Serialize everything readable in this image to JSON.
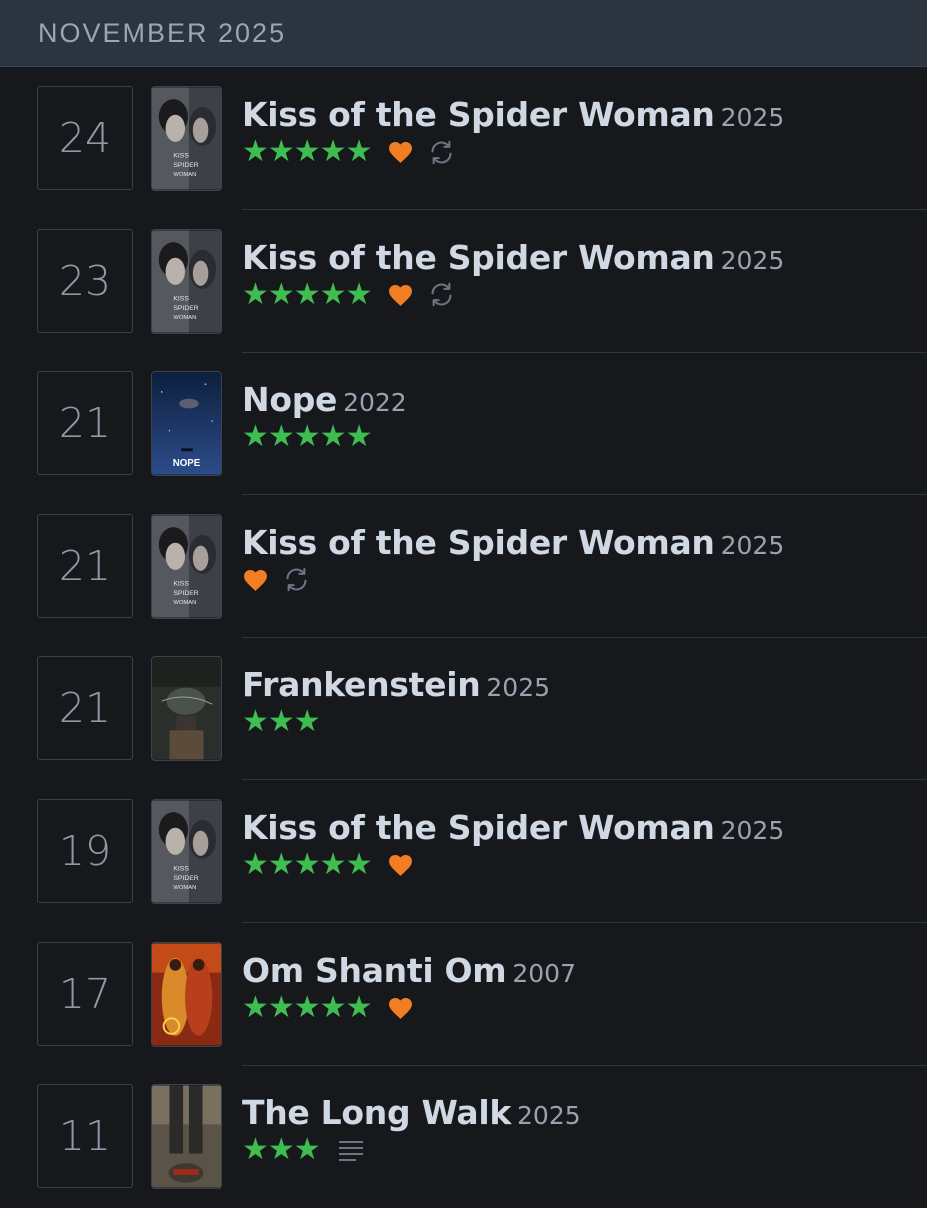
{
  "header": {
    "month": "NOVEMBER 2025"
  },
  "colors": {
    "star": "#40bd50",
    "heart": "#f27d22",
    "icon_muted": "#6b7683"
  },
  "entries": [
    {
      "day": "24",
      "title": "Kiss of the Spider Woman",
      "year": "2025",
      "stars": "★★★★★",
      "liked": true,
      "rewatch": true,
      "review": false,
      "poster": "spider-woman-poster"
    },
    {
      "day": "23",
      "title": "Kiss of the Spider Woman",
      "year": "2025",
      "stars": "★★★★★",
      "liked": true,
      "rewatch": true,
      "review": false,
      "poster": "spider-woman-poster"
    },
    {
      "day": "21",
      "title": "Nope",
      "year": "2022",
      "stars": "★★★★★",
      "liked": false,
      "rewatch": false,
      "review": false,
      "poster": "nope-poster"
    },
    {
      "day": "21",
      "title": "Kiss of the Spider Woman",
      "year": "2025",
      "stars": "",
      "liked": true,
      "rewatch": true,
      "review": false,
      "poster": "spider-woman-poster"
    },
    {
      "day": "21",
      "title": "Frankenstein",
      "year": "2025",
      "stars": "★★★",
      "liked": false,
      "rewatch": false,
      "review": false,
      "poster": "frankenstein-poster"
    },
    {
      "day": "19",
      "title": "Kiss of the Spider Woman",
      "year": "2025",
      "stars": "★★★★★",
      "liked": true,
      "rewatch": false,
      "review": false,
      "poster": "spider-woman-poster"
    },
    {
      "day": "17",
      "title": "Om Shanti Om",
      "year": "2007",
      "stars": "★★★★★",
      "liked": true,
      "rewatch": false,
      "review": false,
      "poster": "om-shanti-om-poster"
    },
    {
      "day": "11",
      "title": "The Long Walk",
      "year": "2025",
      "stars": "★★★",
      "liked": false,
      "rewatch": false,
      "review": true,
      "poster": "long-walk-poster"
    }
  ],
  "poster_text": {
    "spider": [
      "KISS",
      "SPIDER",
      "WOMAN"
    ],
    "nope": "NOPE"
  }
}
